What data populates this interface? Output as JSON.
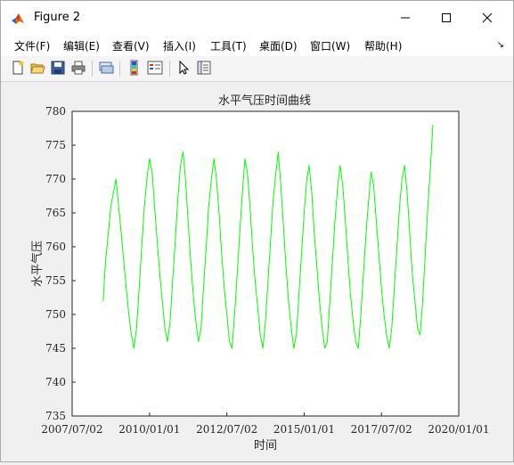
{
  "window": {
    "title": "Figure 2",
    "minimize_symbol": "—",
    "close_symbol": "✕"
  },
  "menu": {
    "items": [
      "文件(F)",
      "编辑(E)",
      "查看(V)",
      "插入(I)",
      "工具(T)",
      "桌面(D)",
      "窗口(W)",
      "帮助(H)"
    ],
    "overflow_symbol": "↘"
  },
  "toolbar": {
    "icons": [
      "new-figure-icon",
      "open-file-icon",
      "save-icon",
      "print-icon",
      "link-plot-icon",
      "colorbar-icon",
      "legend-icon",
      "pointer-icon",
      "property-inspector-icon"
    ]
  },
  "chart_data": {
    "type": "line",
    "title": "水平气压时间曲线",
    "xlabel": "时间",
    "ylabel": "水平气压",
    "color": "#00ff00",
    "xlim": [
      "2007/07/02",
      "2020/01/01"
    ],
    "ylim": [
      735,
      780
    ],
    "xticks": [
      "2007/07/02",
      "2010/01/01",
      "2012/07/02",
      "2015/01/01",
      "2017/07/02",
      "2020/01/01"
    ],
    "yticks": [
      "735",
      "740",
      "745",
      "750",
      "755",
      "760",
      "765",
      "770",
      "775",
      "780"
    ],
    "grid": false,
    "series": [
      {
        "x": [
          "2008/07/01",
          "2008/08/01",
          "2008/09/01",
          "2008/10/01",
          "2008/11/01",
          "2008/12/01",
          "2009/01/01",
          "2009/02/01",
          "2009/03/01",
          "2009/04/01",
          "2009/05/01",
          "2009/06/01",
          "2009/07/01",
          "2009/08/01",
          "2009/09/01",
          "2009/10/01",
          "2009/11/01",
          "2009/12/01",
          "2010/01/01",
          "2010/02/01",
          "2010/03/01",
          "2010/04/01",
          "2010/05/01",
          "2010/06/01",
          "2010/07/01",
          "2010/08/01",
          "2010/09/01",
          "2010/10/01",
          "2010/11/01",
          "2010/12/01",
          "2011/01/01",
          "2011/02/01",
          "2011/03/01",
          "2011/04/01",
          "2011/05/01",
          "2011/06/01",
          "2011/07/01",
          "2011/08/01",
          "2011/09/01",
          "2011/10/01",
          "2011/11/01",
          "2011/12/01",
          "2012/01/01",
          "2012/02/01",
          "2012/03/01",
          "2012/04/01",
          "2012/05/01",
          "2012/06/01",
          "2012/07/01",
          "2012/08/01",
          "2012/09/01",
          "2012/10/01",
          "2012/11/01",
          "2012/12/01",
          "2013/01/01",
          "2013/02/01",
          "2013/03/01",
          "2013/04/01",
          "2013/05/01",
          "2013/06/01",
          "2013/07/01",
          "2013/08/01",
          "2013/09/01",
          "2013/10/01",
          "2013/11/01",
          "2013/12/01",
          "2014/01/01",
          "2014/02/01",
          "2014/03/01",
          "2014/04/01",
          "2014/05/01",
          "2014/06/01",
          "2014/07/01",
          "2014/08/01",
          "2014/09/01",
          "2014/10/01",
          "2014/11/01",
          "2014/12/01",
          "2015/01/01",
          "2015/02/01",
          "2015/03/01",
          "2015/04/01",
          "2015/05/01",
          "2015/06/01",
          "2015/07/01",
          "2015/08/01",
          "2015/09/01",
          "2015/10/01",
          "2015/11/01",
          "2015/12/01",
          "2016/01/01",
          "2016/02/01",
          "2016/03/01",
          "2016/04/01",
          "2016/05/01",
          "2016/06/01",
          "2016/07/01",
          "2016/08/01",
          "2016/09/01",
          "2016/10/01",
          "2016/11/01",
          "2016/12/01",
          "2017/01/01",
          "2017/02/01",
          "2017/03/01",
          "2017/04/01",
          "2017/05/01",
          "2017/06/01",
          "2017/07/01",
          "2017/08/01",
          "2017/09/01",
          "2017/10/01",
          "2017/11/01",
          "2017/12/01",
          "2018/01/01",
          "2018/02/01",
          "2018/03/01",
          "2018/04/01",
          "2018/05/01",
          "2018/06/01",
          "2018/07/01",
          "2018/08/01",
          "2018/09/01",
          "2018/10/01",
          "2018/11/01",
          "2018/12/01",
          "2019/01/01",
          "2019/02/01",
          "2019/03/01"
        ],
        "y": [
          752,
          758,
          762,
          766,
          768,
          770,
          766,
          762,
          758,
          754,
          750,
          747,
          745,
          748,
          754,
          760,
          766,
          770,
          773,
          771,
          766,
          761,
          756,
          752,
          748,
          746,
          749,
          755,
          761,
          767,
          772,
          774,
          770,
          764,
          758,
          753,
          749,
          746,
          748,
          754,
          760,
          766,
          770,
          773,
          770,
          765,
          759,
          754,
          750,
          746,
          745,
          750,
          756,
          762,
          768,
          773,
          771,
          766,
          760,
          755,
          751,
          747,
          745,
          749,
          755,
          761,
          767,
          771,
          774,
          769,
          763,
          757,
          752,
          748,
          745,
          747,
          753,
          759,
          765,
          770,
          772,
          768,
          762,
          757,
          752,
          748,
          745,
          746,
          752,
          758,
          764,
          769,
          772,
          769,
          764,
          758,
          753,
          749,
          746,
          745,
          750,
          756,
          762,
          767,
          771,
          769,
          764,
          759,
          754,
          750,
          747,
          745,
          748,
          754,
          760,
          766,
          770,
          772,
          768,
          762,
          756,
          752,
          748,
          747,
          752,
          759,
          766,
          772,
          778
        ]
      }
    ]
  }
}
